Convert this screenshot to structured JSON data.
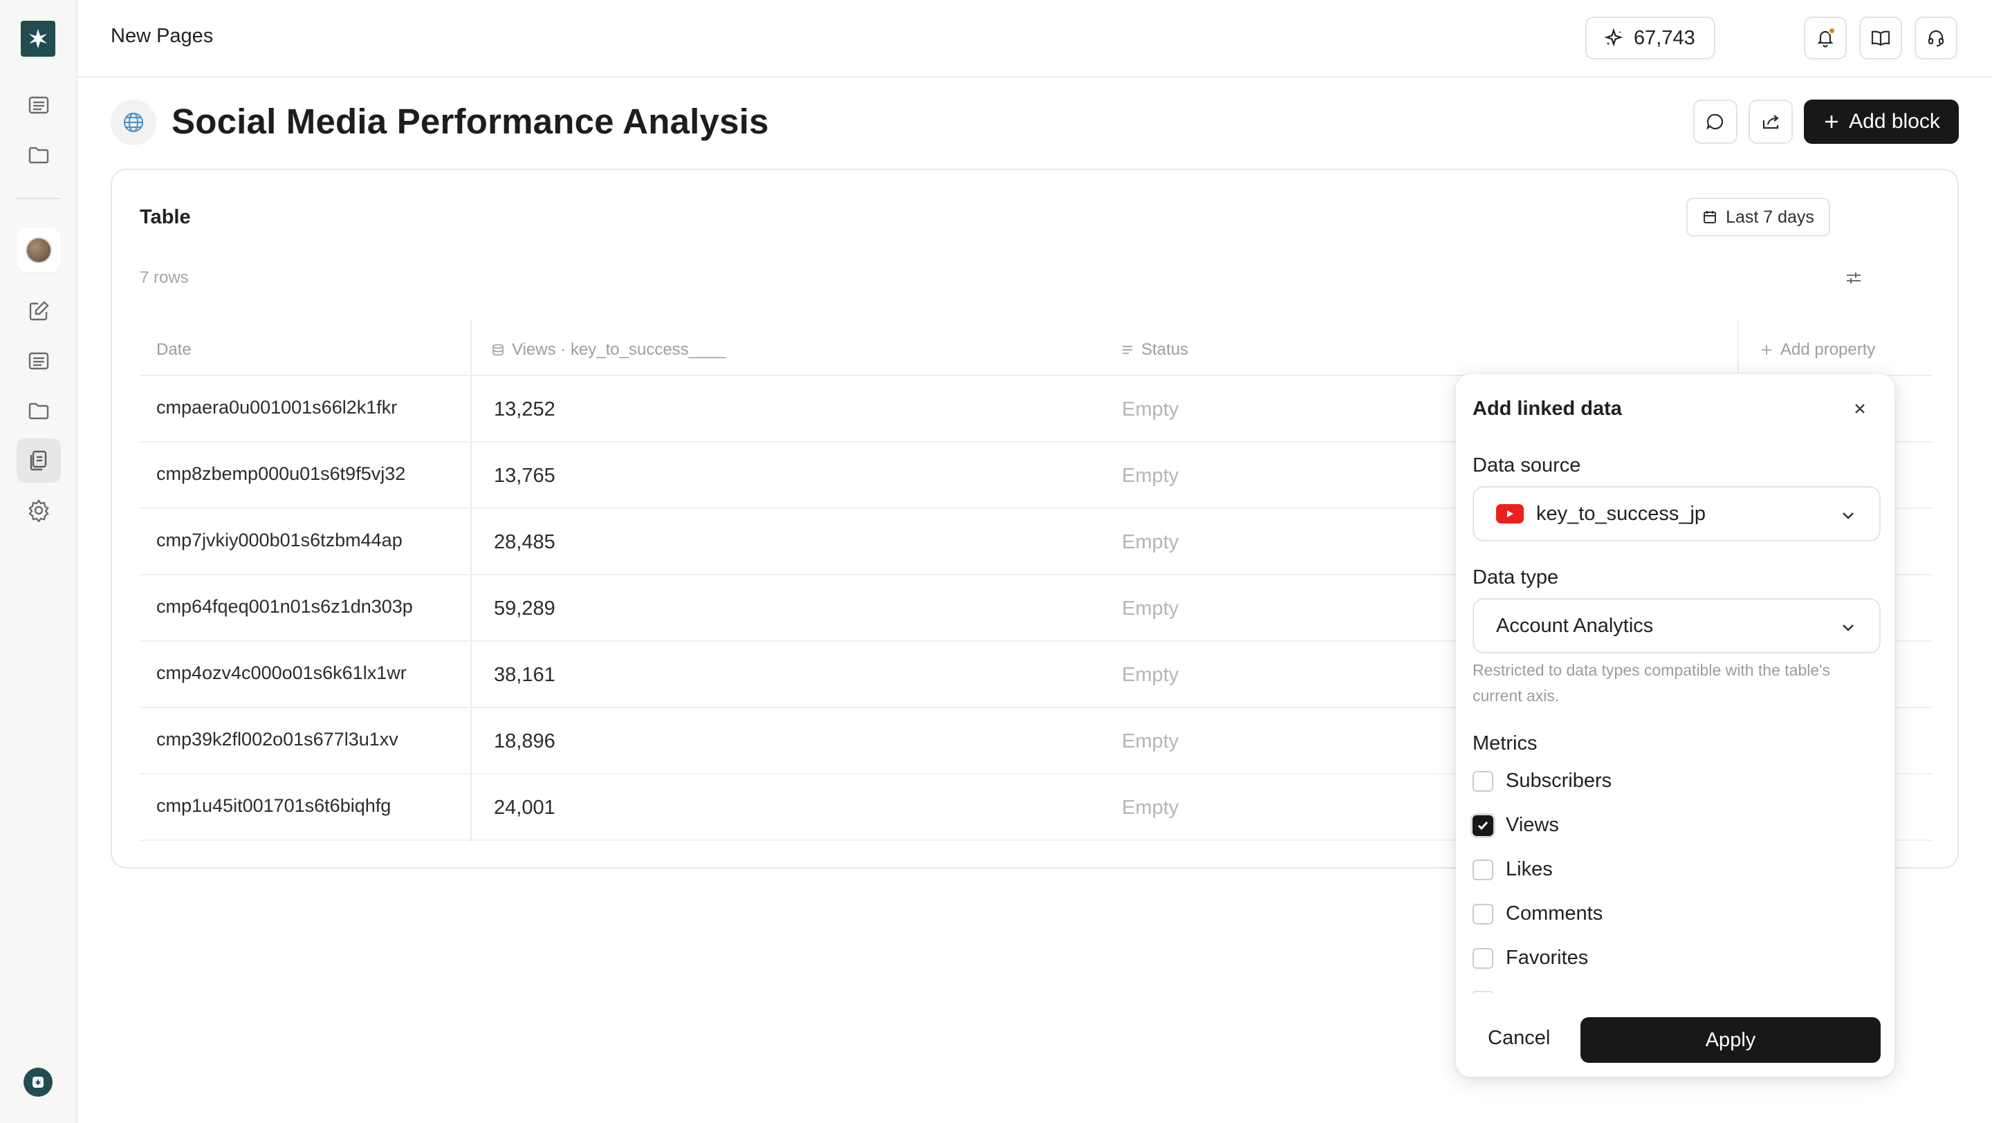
{
  "breadcrumb": "New Pages",
  "credits": "67,743",
  "page": {
    "title": "Social Media Performance Analysis",
    "add_block_label": "Add block"
  },
  "table": {
    "title": "Table",
    "range_label": "Last 7 days",
    "row_count": "7 rows",
    "columns": {
      "date": "Date",
      "views": "Views · key_to_success____",
      "status": "Status",
      "add_property": "Add property"
    },
    "rows": [
      {
        "date": "cmpaera0u001001s66l2k1fkr",
        "views": "13,252",
        "status": "Empty"
      },
      {
        "date": "cmp8zbemp000u01s6t9f5vj32",
        "views": "13,765",
        "status": "Empty"
      },
      {
        "date": "cmp7jvkiy000b01s6tzbm44ap",
        "views": "28,485",
        "status": "Empty"
      },
      {
        "date": "cmp64fqeq001n01s6z1dn303p",
        "views": "59,289",
        "status": "Empty"
      },
      {
        "date": "cmp4ozv4c000o01s6k61lx1wr",
        "views": "38,161",
        "status": "Empty"
      },
      {
        "date": "cmp39k2fl002o01s677l3u1xv",
        "views": "18,896",
        "status": "Empty"
      },
      {
        "date": "cmp1u45it001701s6t6biqhfg",
        "views": "24,001",
        "status": "Empty"
      }
    ]
  },
  "popover": {
    "title": "Add linked data",
    "data_source_label": "Data source",
    "data_source_value": "key_to_success_jp",
    "data_type_label": "Data type",
    "data_type_value": "Account Analytics",
    "hint": "Restricted to data types compatible with the table's current axis.",
    "metrics_label": "Metrics",
    "metrics": [
      {
        "label": "Subscribers",
        "checked": false
      },
      {
        "label": "Views",
        "checked": true
      },
      {
        "label": "Likes",
        "checked": false
      },
      {
        "label": "Comments",
        "checked": false
      },
      {
        "label": "Favorites",
        "checked": false
      }
    ],
    "cancel_label": "Cancel",
    "apply_label": "Apply"
  },
  "colors": {
    "brand": "#234c51",
    "primary_button": "#17181a",
    "youtube": "#ee1f1f",
    "notification_dot": "#d4862b"
  }
}
